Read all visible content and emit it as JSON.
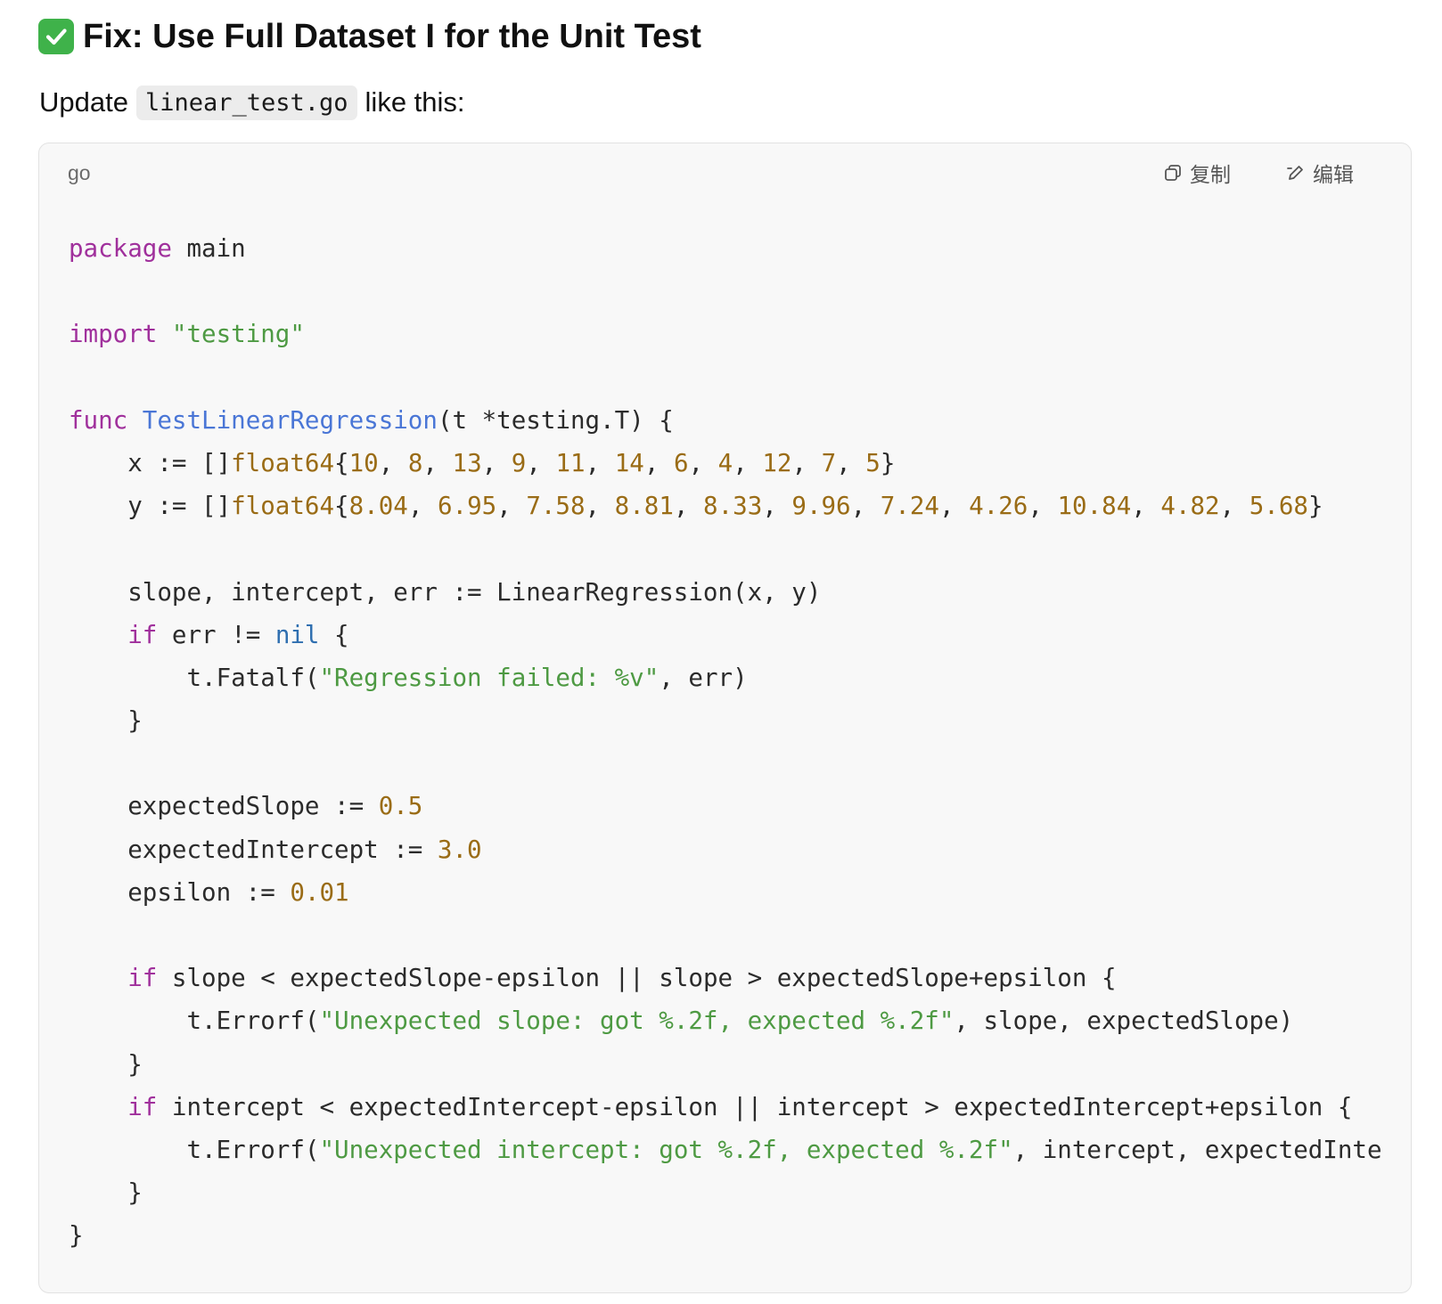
{
  "heading": {
    "icon": "check-mark-button-icon",
    "text": "Fix: Use Full Dataset I for the Unit Test"
  },
  "intro": {
    "before": "Update",
    "filename": "linear_test.go",
    "after": "like this:"
  },
  "code_block": {
    "language": "go",
    "copy_label": "复制",
    "edit_label": "编辑",
    "lines": [
      [
        {
          "t": "package",
          "k": "keyword"
        },
        {
          "t": " main",
          "k": "plain"
        }
      ],
      [],
      [
        {
          "t": "import",
          "k": "keyword"
        },
        {
          "t": " ",
          "k": "plain"
        },
        {
          "t": "\"testing\"",
          "k": "string"
        }
      ],
      [],
      [
        {
          "t": "func",
          "k": "keyword"
        },
        {
          "t": " ",
          "k": "plain"
        },
        {
          "t": "TestLinearRegression",
          "k": "func"
        },
        {
          "t": "(t *testing.T) {",
          "k": "plain"
        }
      ],
      [
        {
          "t": "    x := []",
          "k": "plain"
        },
        {
          "t": "float64",
          "k": "type"
        },
        {
          "t": "{",
          "k": "plain"
        },
        {
          "t": "10",
          "k": "number"
        },
        {
          "t": ", ",
          "k": "plain"
        },
        {
          "t": "8",
          "k": "number"
        },
        {
          "t": ", ",
          "k": "plain"
        },
        {
          "t": "13",
          "k": "number"
        },
        {
          "t": ", ",
          "k": "plain"
        },
        {
          "t": "9",
          "k": "number"
        },
        {
          "t": ", ",
          "k": "plain"
        },
        {
          "t": "11",
          "k": "number"
        },
        {
          "t": ", ",
          "k": "plain"
        },
        {
          "t": "14",
          "k": "number"
        },
        {
          "t": ", ",
          "k": "plain"
        },
        {
          "t": "6",
          "k": "number"
        },
        {
          "t": ", ",
          "k": "plain"
        },
        {
          "t": "4",
          "k": "number"
        },
        {
          "t": ", ",
          "k": "plain"
        },
        {
          "t": "12",
          "k": "number"
        },
        {
          "t": ", ",
          "k": "plain"
        },
        {
          "t": "7",
          "k": "number"
        },
        {
          "t": ", ",
          "k": "plain"
        },
        {
          "t": "5",
          "k": "number"
        },
        {
          "t": "}",
          "k": "plain"
        }
      ],
      [
        {
          "t": "    y := []",
          "k": "plain"
        },
        {
          "t": "float64",
          "k": "type"
        },
        {
          "t": "{",
          "k": "plain"
        },
        {
          "t": "8.04",
          "k": "number"
        },
        {
          "t": ", ",
          "k": "plain"
        },
        {
          "t": "6.95",
          "k": "number"
        },
        {
          "t": ", ",
          "k": "plain"
        },
        {
          "t": "7.58",
          "k": "number"
        },
        {
          "t": ", ",
          "k": "plain"
        },
        {
          "t": "8.81",
          "k": "number"
        },
        {
          "t": ", ",
          "k": "plain"
        },
        {
          "t": "8.33",
          "k": "number"
        },
        {
          "t": ", ",
          "k": "plain"
        },
        {
          "t": "9.96",
          "k": "number"
        },
        {
          "t": ", ",
          "k": "plain"
        },
        {
          "t": "7.24",
          "k": "number"
        },
        {
          "t": ", ",
          "k": "plain"
        },
        {
          "t": "4.26",
          "k": "number"
        },
        {
          "t": ", ",
          "k": "plain"
        },
        {
          "t": "10.84",
          "k": "number"
        },
        {
          "t": ", ",
          "k": "plain"
        },
        {
          "t": "4.82",
          "k": "number"
        },
        {
          "t": ", ",
          "k": "plain"
        },
        {
          "t": "5.68",
          "k": "number"
        },
        {
          "t": "}",
          "k": "plain"
        }
      ],
      [],
      [
        {
          "t": "    slope, intercept, err := LinearRegression(x, y)",
          "k": "plain"
        }
      ],
      [
        {
          "t": "    ",
          "k": "plain"
        },
        {
          "t": "if",
          "k": "keyword"
        },
        {
          "t": " err != ",
          "k": "plain"
        },
        {
          "t": "nil",
          "k": "builtin"
        },
        {
          "t": " {",
          "k": "plain"
        }
      ],
      [
        {
          "t": "        t.Fatalf(",
          "k": "plain"
        },
        {
          "t": "\"Regression failed: %v\"",
          "k": "string"
        },
        {
          "t": ", err)",
          "k": "plain"
        }
      ],
      [
        {
          "t": "    }",
          "k": "plain"
        }
      ],
      [],
      [
        {
          "t": "    expectedSlope := ",
          "k": "plain"
        },
        {
          "t": "0.5",
          "k": "number"
        }
      ],
      [
        {
          "t": "    expectedIntercept := ",
          "k": "plain"
        },
        {
          "t": "3.0",
          "k": "number"
        }
      ],
      [
        {
          "t": "    epsilon := ",
          "k": "plain"
        },
        {
          "t": "0.01",
          "k": "number"
        }
      ],
      [],
      [
        {
          "t": "    ",
          "k": "plain"
        },
        {
          "t": "if",
          "k": "keyword"
        },
        {
          "t": " slope < expectedSlope-epsilon || slope > expectedSlope+epsilon {",
          "k": "plain"
        }
      ],
      [
        {
          "t": "        t.Errorf(",
          "k": "plain"
        },
        {
          "t": "\"Unexpected slope: got %.2f, expected %.2f\"",
          "k": "string"
        },
        {
          "t": ", slope, expectedSlope)",
          "k": "plain"
        }
      ],
      [
        {
          "t": "    }",
          "k": "plain"
        }
      ],
      [
        {
          "t": "    ",
          "k": "plain"
        },
        {
          "t": "if",
          "k": "keyword"
        },
        {
          "t": " intercept < expectedIntercept-epsilon || intercept > expectedIntercept+epsilon {",
          "k": "plain"
        }
      ],
      [
        {
          "t": "        t.Errorf(",
          "k": "plain"
        },
        {
          "t": "\"Unexpected intercept: got %.2f, expected %.2f\"",
          "k": "string"
        },
        {
          "t": ", intercept, expectedInte",
          "k": "plain"
        }
      ],
      [
        {
          "t": "    }",
          "k": "plain"
        }
      ],
      [
        {
          "t": "}",
          "k": "plain"
        }
      ]
    ]
  },
  "colors": {
    "keyword": "#a0309c",
    "string": "#4e9a43",
    "number": "#9a6c16",
    "function_name": "#4a76d6",
    "builtin": "#2f6fb0",
    "code_background": "#f8f8f8",
    "check_badge": "#3fb24a"
  }
}
